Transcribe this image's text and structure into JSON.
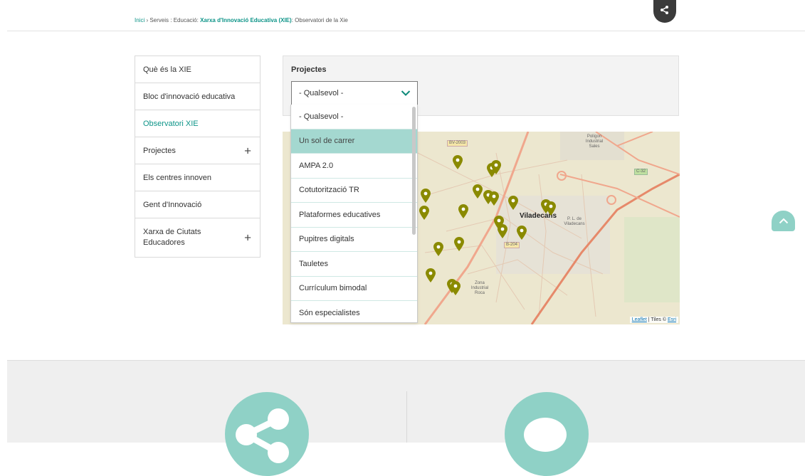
{
  "breadcrumb": {
    "home": "Inici",
    "sep1": " › ",
    "services": "Serveis",
    "sep2": " : ",
    "education": "Educació",
    "sep3": ": ",
    "network": "Xarxa d'Innovació Educativa (XIE)",
    "sep4": ": ",
    "current": "Observatori de la Xie"
  },
  "sidebar": {
    "items": [
      {
        "label": "Què és la XIE"
      },
      {
        "label": "Bloc d'innovació educativa"
      },
      {
        "label": "Observatori XIE"
      },
      {
        "label": "Projectes",
        "expand": "+"
      },
      {
        "label": "Els centres innoven"
      },
      {
        "label": "Gent d'Innovació"
      },
      {
        "label": "Xarxa de Ciutats Educadores",
        "expand": "+"
      }
    ]
  },
  "filter": {
    "label": "Projectes",
    "selected": "- Qualsevol -",
    "options": [
      "- Qualsevol -",
      "Un sol de carrer",
      "AMPA 2.0",
      "Cotutorització TR",
      "Plataformes educatives",
      "Pupitres digitals",
      "Tauletes",
      "Currículum bimodal",
      "Són especialistes"
    ],
    "highlighted_index": 1
  },
  "map": {
    "city_label": "Viladecans",
    "labels": {
      "poligon": "Polígon Industrial Sales",
      "zona": "Zona Industrial Roca",
      "pl": "P. L. de Viladecans",
      "bv2003": "BV-2003",
      "b204": "B-204",
      "c32": "C-32"
    },
    "attribution": {
      "leaflet": "Leaflet",
      "sep": " | Tiles © ",
      "esri": "Esri"
    },
    "marker_color": "#8a8a00"
  },
  "colors": {
    "accent": "#0d9488",
    "teal_light": "#8fd1c6",
    "selected_option": "#a4d8d0"
  },
  "icons": [
    "share-icon",
    "chevron-down-icon",
    "chevron-up-icon",
    "map-marker-icon",
    "chat-icon"
  ]
}
